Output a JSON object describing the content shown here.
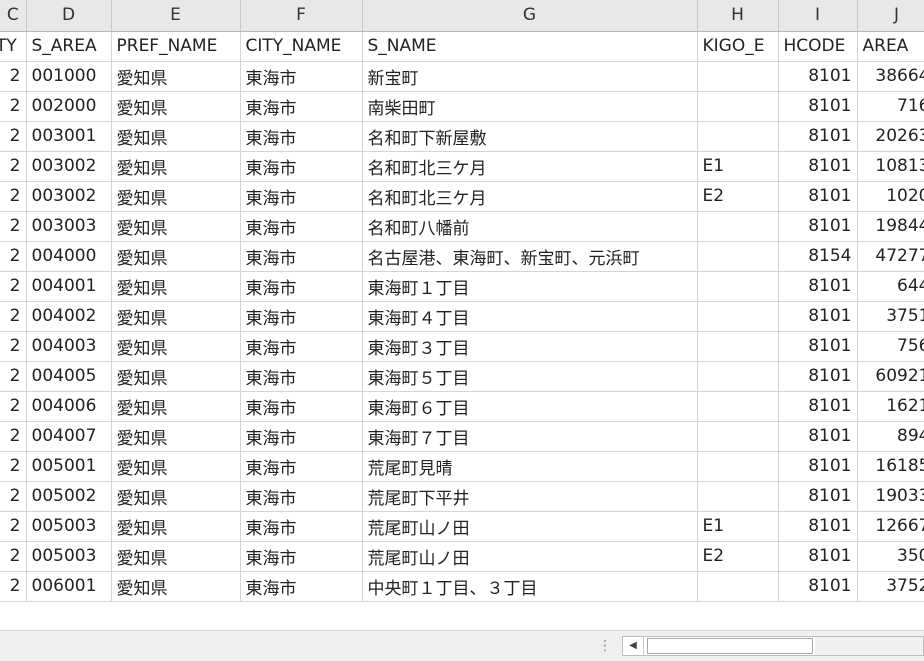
{
  "columns": [
    "C",
    "D",
    "E",
    "F",
    "G",
    "H",
    "I",
    "J"
  ],
  "header": [
    "TY",
    "S_AREA",
    "PREF_NAME",
    "CITY_NAME",
    "S_NAME",
    "KIGO_E",
    "HCODE",
    "AREA"
  ],
  "rows": [
    [
      "2",
      "001000",
      "愛知県",
      "東海市",
      "新宝町",
      "",
      "8101",
      "38664"
    ],
    [
      "2",
      "002000",
      "愛知県",
      "東海市",
      "南柴田町",
      "",
      "8101",
      "716"
    ],
    [
      "2",
      "003001",
      "愛知県",
      "東海市",
      "名和町下新屋敷",
      "",
      "8101",
      "20263"
    ],
    [
      "2",
      "003002",
      "愛知県",
      "東海市",
      "名和町北三ケ月",
      "E1",
      "8101",
      "10813"
    ],
    [
      "2",
      "003002",
      "愛知県",
      "東海市",
      "名和町北三ケ月",
      "E2",
      "8101",
      "1020"
    ],
    [
      "2",
      "003003",
      "愛知県",
      "東海市",
      "名和町八幡前",
      "",
      "8101",
      "19844"
    ],
    [
      "2",
      "004000",
      "愛知県",
      "東海市",
      "名古屋港、東海町、新宝町、元浜町",
      "",
      "8154",
      "47277"
    ],
    [
      "2",
      "004001",
      "愛知県",
      "東海市",
      "東海町１丁目",
      "",
      "8101",
      "644"
    ],
    [
      "2",
      "004002",
      "愛知県",
      "東海市",
      "東海町４丁目",
      "",
      "8101",
      "3751"
    ],
    [
      "2",
      "004003",
      "愛知県",
      "東海市",
      "東海町３丁目",
      "",
      "8101",
      "756"
    ],
    [
      "2",
      "004005",
      "愛知県",
      "東海市",
      "東海町５丁目",
      "",
      "8101",
      "60921"
    ],
    [
      "2",
      "004006",
      "愛知県",
      "東海市",
      "東海町６丁目",
      "",
      "8101",
      "1621"
    ],
    [
      "2",
      "004007",
      "愛知県",
      "東海市",
      "東海町７丁目",
      "",
      "8101",
      "894"
    ],
    [
      "2",
      "005001",
      "愛知県",
      "東海市",
      "荒尾町見晴",
      "",
      "8101",
      "16185"
    ],
    [
      "2",
      "005002",
      "愛知県",
      "東海市",
      "荒尾町下平井",
      "",
      "8101",
      "19033"
    ],
    [
      "2",
      "005003",
      "愛知県",
      "東海市",
      "荒尾町山ノ田",
      "E1",
      "8101",
      "12667"
    ],
    [
      "2",
      "005003",
      "愛知県",
      "東海市",
      "荒尾町山ノ田",
      "E2",
      "8101",
      "350"
    ],
    [
      "2",
      "006001",
      "愛知県",
      "東海市",
      "中央町１丁目、３丁目",
      "",
      "8101",
      "3752"
    ]
  ],
  "statusbar": {
    "split_icon": "split-handle-icon",
    "scroll_left_icon": "scroll-left-arrow-icon"
  }
}
